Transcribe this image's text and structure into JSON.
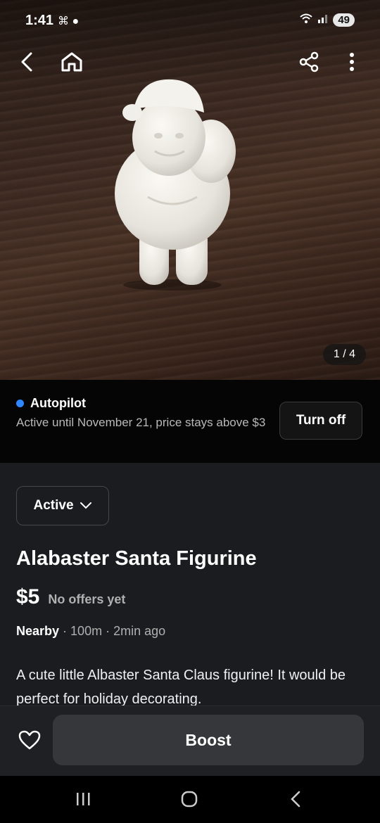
{
  "status_bar": {
    "time": "1:41",
    "battery": "49"
  },
  "photo": {
    "counter": "1 / 4"
  },
  "autopilot": {
    "label": "Autopilot",
    "description": "Active until November 21, price stays above $3",
    "turn_off_label": "Turn off",
    "status_color": "#2d88ff"
  },
  "listing": {
    "status": "Active",
    "title": "Alabaster Santa Figurine",
    "price": "$5",
    "offers": "No offers yet",
    "location": "Nearby",
    "distance": "· 100m · 2min ago",
    "description": "A cute little Albaster Santa Claus figurine! It would be perfect for holiday decorating."
  },
  "bottom": {
    "boost_label": "Boost"
  },
  "icons": [
    "back-icon",
    "home-icon",
    "share-icon",
    "more-icon",
    "heart-icon",
    "chevron-down-icon"
  ]
}
